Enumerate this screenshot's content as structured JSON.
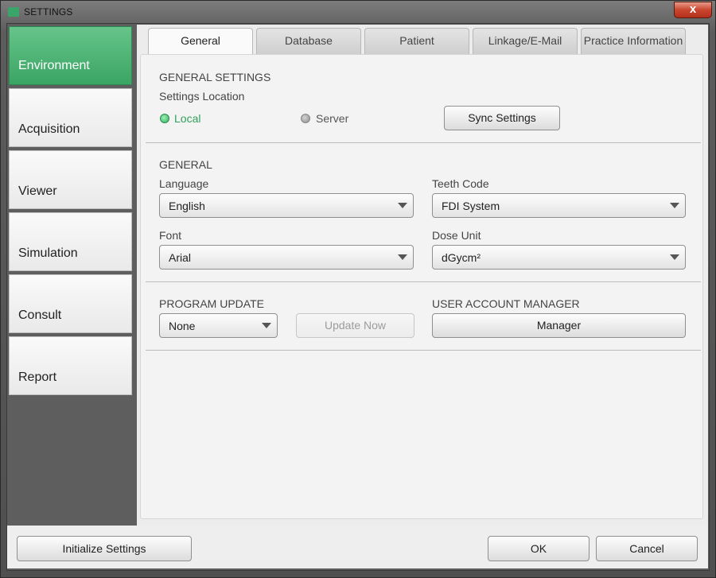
{
  "window": {
    "title": "SETTINGS",
    "close_glyph": "x"
  },
  "sidebar": {
    "items": [
      {
        "label": "Environment",
        "active": true
      },
      {
        "label": "Acquisition",
        "active": false
      },
      {
        "label": "Viewer",
        "active": false
      },
      {
        "label": "Simulation",
        "active": false
      },
      {
        "label": "Consult",
        "active": false
      },
      {
        "label": "Report",
        "active": false
      }
    ]
  },
  "tabs": [
    {
      "label": "General",
      "active": true
    },
    {
      "label": "Database",
      "active": false
    },
    {
      "label": "Patient",
      "active": false
    },
    {
      "label": "Linkage/E-Mail",
      "active": false
    },
    {
      "label": "Practice Information",
      "active": false
    }
  ],
  "general_settings": {
    "title": "GENERAL SETTINGS",
    "location_label": "Settings Location",
    "options": [
      {
        "label": "Local",
        "selected": true
      },
      {
        "label": "Server",
        "selected": false
      }
    ],
    "sync_button": "Sync Settings"
  },
  "general": {
    "title": "GENERAL",
    "language_label": "Language",
    "language_value": "English",
    "teeth_code_label": "Teeth Code",
    "teeth_code_value": "FDI System",
    "font_label": "Font",
    "font_value": "Arial",
    "dose_unit_label": "Dose Unit",
    "dose_unit_value": "dGycm²"
  },
  "program_update": {
    "title": "PROGRAM UPDATE",
    "value": "None",
    "update_button": "Update Now",
    "update_enabled": false
  },
  "user_account": {
    "title": "USER ACCOUNT MANAGER",
    "manager_button": "Manager"
  },
  "footer": {
    "initialize_button": "Initialize Settings",
    "ok_button": "OK",
    "cancel_button": "Cancel"
  },
  "colors": {
    "accent_green": "#3aa565",
    "active_radio": "#2fb060"
  }
}
